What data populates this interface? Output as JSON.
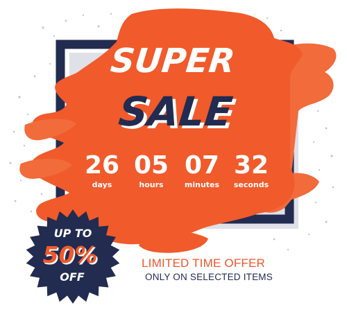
{
  "headline": {
    "line1": "SUPER",
    "line2": "SALE"
  },
  "countdown": [
    {
      "value": "26",
      "unit": "days"
    },
    {
      "value": "05",
      "unit": "hours"
    },
    {
      "value": "07",
      "unit": "minutes"
    },
    {
      "value": "32",
      "unit": "seconds"
    }
  ],
  "badge": {
    "line1": "UP TO",
    "line2": "50%",
    "line3": "OFF"
  },
  "offer": {
    "line1": "LIMITED TIME OFFER",
    "line2": "ONLY ON SELECTED ITEMS"
  },
  "colors": {
    "orange": "#f15a2b",
    "orange_light": "#f26b3a",
    "navy": "#222b50",
    "frame_shadow": "#dfe0e8",
    "white": "#ffffff"
  }
}
